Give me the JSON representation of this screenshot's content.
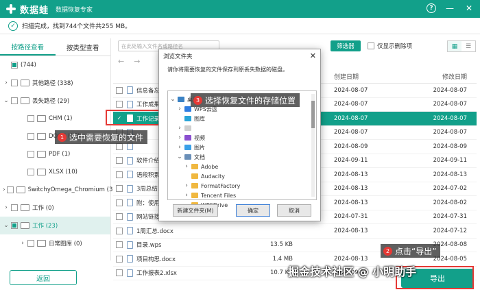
{
  "app": {
    "name": "数据蛙",
    "subtitle": "数据恢复专家",
    "accent": "#12a08a"
  },
  "status": {
    "text": "扫描完成，找到744个文件共255 MB。"
  },
  "left_tabs": [
    "按路径查看",
    "按类型查看"
  ],
  "tree": [
    {
      "label": "(744)",
      "indent": 0,
      "chev": "",
      "cb": "part",
      "sel": false
    },
    {
      "label": "其他路径 (338)",
      "indent": 0,
      "chev": "›",
      "cb": "",
      "sel": false
    },
    {
      "label": "丢失路径 (29)",
      "indent": 0,
      "chev": "⌄",
      "cb": "",
      "sel": false
    },
    {
      "label": "CHM (1)",
      "indent": 2,
      "chev": "",
      "cb": "",
      "sel": false
    },
    {
      "label": "DOCX (17)",
      "indent": 2,
      "chev": "",
      "cb": "",
      "sel": false
    },
    {
      "label": "PDF (1)",
      "indent": 2,
      "chev": "",
      "cb": "",
      "sel": false
    },
    {
      "label": "XLSX (10)",
      "indent": 2,
      "chev": "",
      "cb": "",
      "sel": false
    },
    {
      "label": "SwitchyOmega_Chromium (3",
      "indent": 0,
      "chev": "›",
      "cb": "",
      "sel": false
    },
    {
      "label": "工作 (0)",
      "indent": 0,
      "chev": "›",
      "cb": "",
      "sel": false
    },
    {
      "label": "工作 (23)",
      "indent": 0,
      "chev": "⌄",
      "cb": "part",
      "sel": true
    },
    {
      "label": "日常图库 (0)",
      "indent": 2,
      "chev": "›",
      "cb": "",
      "sel": false
    }
  ],
  "toolbar": {
    "search_placeholder": "在此处输入文件名或路径名",
    "filter_label": "筛选器",
    "only_deleted_label": "仅显示删除项"
  },
  "table": {
    "headers": {
      "name": "名称",
      "size": "",
      "type": "",
      "created": "创建日期",
      "modified": "修改日期"
    },
    "rows": [
      {
        "name": "信息备忘.t",
        "size": "",
        "type": "",
        "created": "2024-08-07",
        "modified": "2024-08-07",
        "sel": false
      },
      {
        "name": "工作成果分",
        "size": "",
        "type": "",
        "created": "2024-08-07",
        "modified": "2024-08-07",
        "sel": false
      },
      {
        "name": "工作记录表",
        "size": "",
        "type": "",
        "created": "2024-08-07",
        "modified": "2024-08-07",
        "sel": true
      },
      {
        "name": "",
        "size": "",
        "type": "",
        "created": "2024-08-07",
        "modified": "2024-08-07",
        "sel": false
      },
      {
        "name": "",
        "size": "",
        "type": "",
        "created": "2024-08-09",
        "modified": "2024-08-09",
        "sel": false
      },
      {
        "name": "软件介绍 -",
        "size": "",
        "type": "",
        "created": "2024-09-11",
        "modified": "2024-09-11",
        "sel": false
      },
      {
        "name": "语段积累.d",
        "size": "",
        "type": "",
        "created": "2024-08-13",
        "modified": "2024-08-13",
        "sel": false
      },
      {
        "name": "3周总结.docx",
        "size": "",
        "type": "",
        "created": "2024-08-13",
        "modified": "2024-07-02",
        "sel": false
      },
      {
        "name": "附：使用注",
        "size": "",
        "type": "",
        "created": "2024-08-13",
        "modified": "2024-08-02",
        "sel": false
      },
      {
        "name": "网站链接.txt",
        "size": "",
        "type": "",
        "created": "2024-07-31",
        "modified": "2024-07-31",
        "sel": false
      },
      {
        "name": "1周汇总.docx",
        "size": "",
        "type": "",
        "created": "2024-08-13",
        "modified": "2024-07-12",
        "sel": false
      },
      {
        "name": "目录.wps",
        "size": "13.5 KB",
        "type": "",
        "created": "",
        "modified": "2024-08-08",
        "sel": false
      },
      {
        "name": "项目构思.docx",
        "size": "1.4 MB",
        "type": "",
        "created": "2024-08-13",
        "modified": "2024-08-05",
        "sel": false
      },
      {
        "name": "工作报表2.xlsx",
        "size": "10.7 KB",
        "type": "",
        "created": "2024-09-13",
        "modified": "2024-09-13",
        "sel": false
      }
    ]
  },
  "dialog": {
    "title": "浏览文件夹",
    "message": "请你将需要恢复的文件保存到原丢失数据的磁盘。",
    "tree": [
      {
        "label": "桌面",
        "indent": 0,
        "chev": "⌄",
        "color": "#3b82c4"
      },
      {
        "label": "WPS云盘",
        "indent": 1,
        "chev": "›",
        "color": "#2f7de1"
      },
      {
        "label": "图库",
        "indent": 1,
        "chev": "",
        "color": "#2aa5d8"
      },
      {
        "label": "",
        "indent": 1,
        "chev": "›",
        "color": "#cfcfcf"
      },
      {
        "label": "视频",
        "indent": 1,
        "chev": "›",
        "color": "#8a4fd0"
      },
      {
        "label": "图片",
        "indent": 1,
        "chev": "›",
        "color": "#3aa0e8"
      },
      {
        "label": "文档",
        "indent": 1,
        "chev": "⌄",
        "color": "#6a8fb8"
      },
      {
        "label": "Adobe",
        "indent": 2,
        "chev": "›",
        "color": "#f0b840"
      },
      {
        "label": "Audacity",
        "indent": 2,
        "chev": "",
        "color": "#f0b840"
      },
      {
        "label": "FormatFactory",
        "indent": 2,
        "chev": "›",
        "color": "#f0b840"
      },
      {
        "label": "Tencent Files",
        "indent": 2,
        "chev": "›",
        "color": "#f0b840"
      },
      {
        "label": "WPSDrive",
        "indent": 2,
        "chev": "",
        "color": "#f0b840"
      }
    ],
    "new_folder_label": "新建文件夹(M)",
    "ok_label": "确定",
    "cancel_label": "取消"
  },
  "buttons": {
    "back": "返回",
    "export": "导出"
  },
  "callouts": {
    "step1": {
      "num": "1",
      "text": "选中需要恢复的文件"
    },
    "step2": {
      "num": "2",
      "text": "点击“导出”"
    },
    "step3": {
      "num": "3",
      "text": "选择恢复文件的存储位置"
    }
  },
  "watermark": "掘金技术社区 @ 小明助手"
}
